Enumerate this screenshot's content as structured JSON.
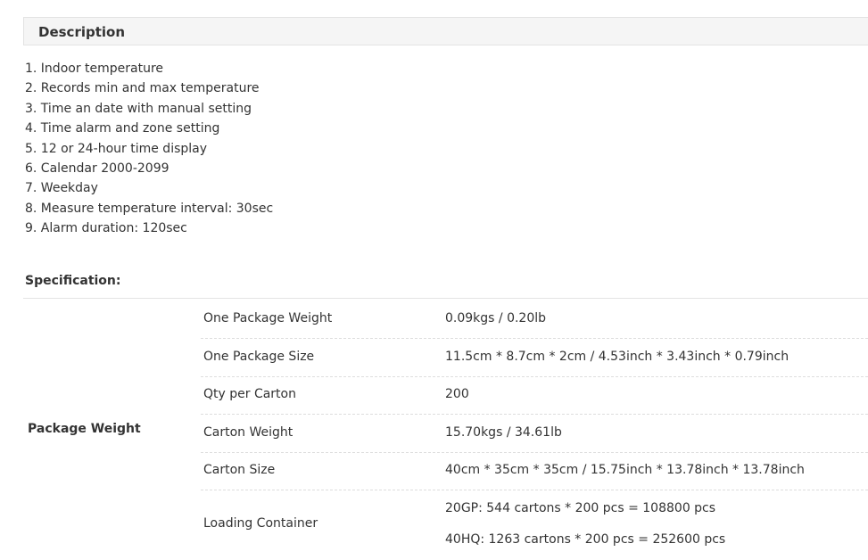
{
  "description": {
    "title": "Description",
    "items": [
      "1. Indoor temperature",
      "2. Records min and max temperature",
      "3. Time an date with manual setting",
      "4. Time alarm and zone setting",
      "5. 12 or 24-hour time display",
      "6. Calendar 2000-2099",
      "7. Weekday",
      "8. Measure temperature interval: 30sec",
      "9. Alarm duration: 120sec"
    ]
  },
  "specification": {
    "title": "Specification:",
    "group_label": "Package Weight",
    "rows": [
      {
        "key": "One Package Weight",
        "value": "0.09kgs / 0.20lb"
      },
      {
        "key": "One Package Size",
        "value": "11.5cm * 8.7cm * 2cm / 4.53inch * 3.43inch * 0.79inch"
      },
      {
        "key": "Qty per Carton",
        "value": "200"
      },
      {
        "key": "Carton Weight",
        "value": "15.70kgs / 34.61lb"
      },
      {
        "key": "Carton Size",
        "value": "40cm * 35cm * 35cm / 15.75inch * 13.78inch * 13.78inch"
      },
      {
        "key": "Loading Container",
        "values": [
          "20GP: 544 cartons * 200 pcs = 108800 pcs",
          "40HQ: 1263 cartons * 200 pcs = 252600 pcs"
        ]
      }
    ]
  }
}
